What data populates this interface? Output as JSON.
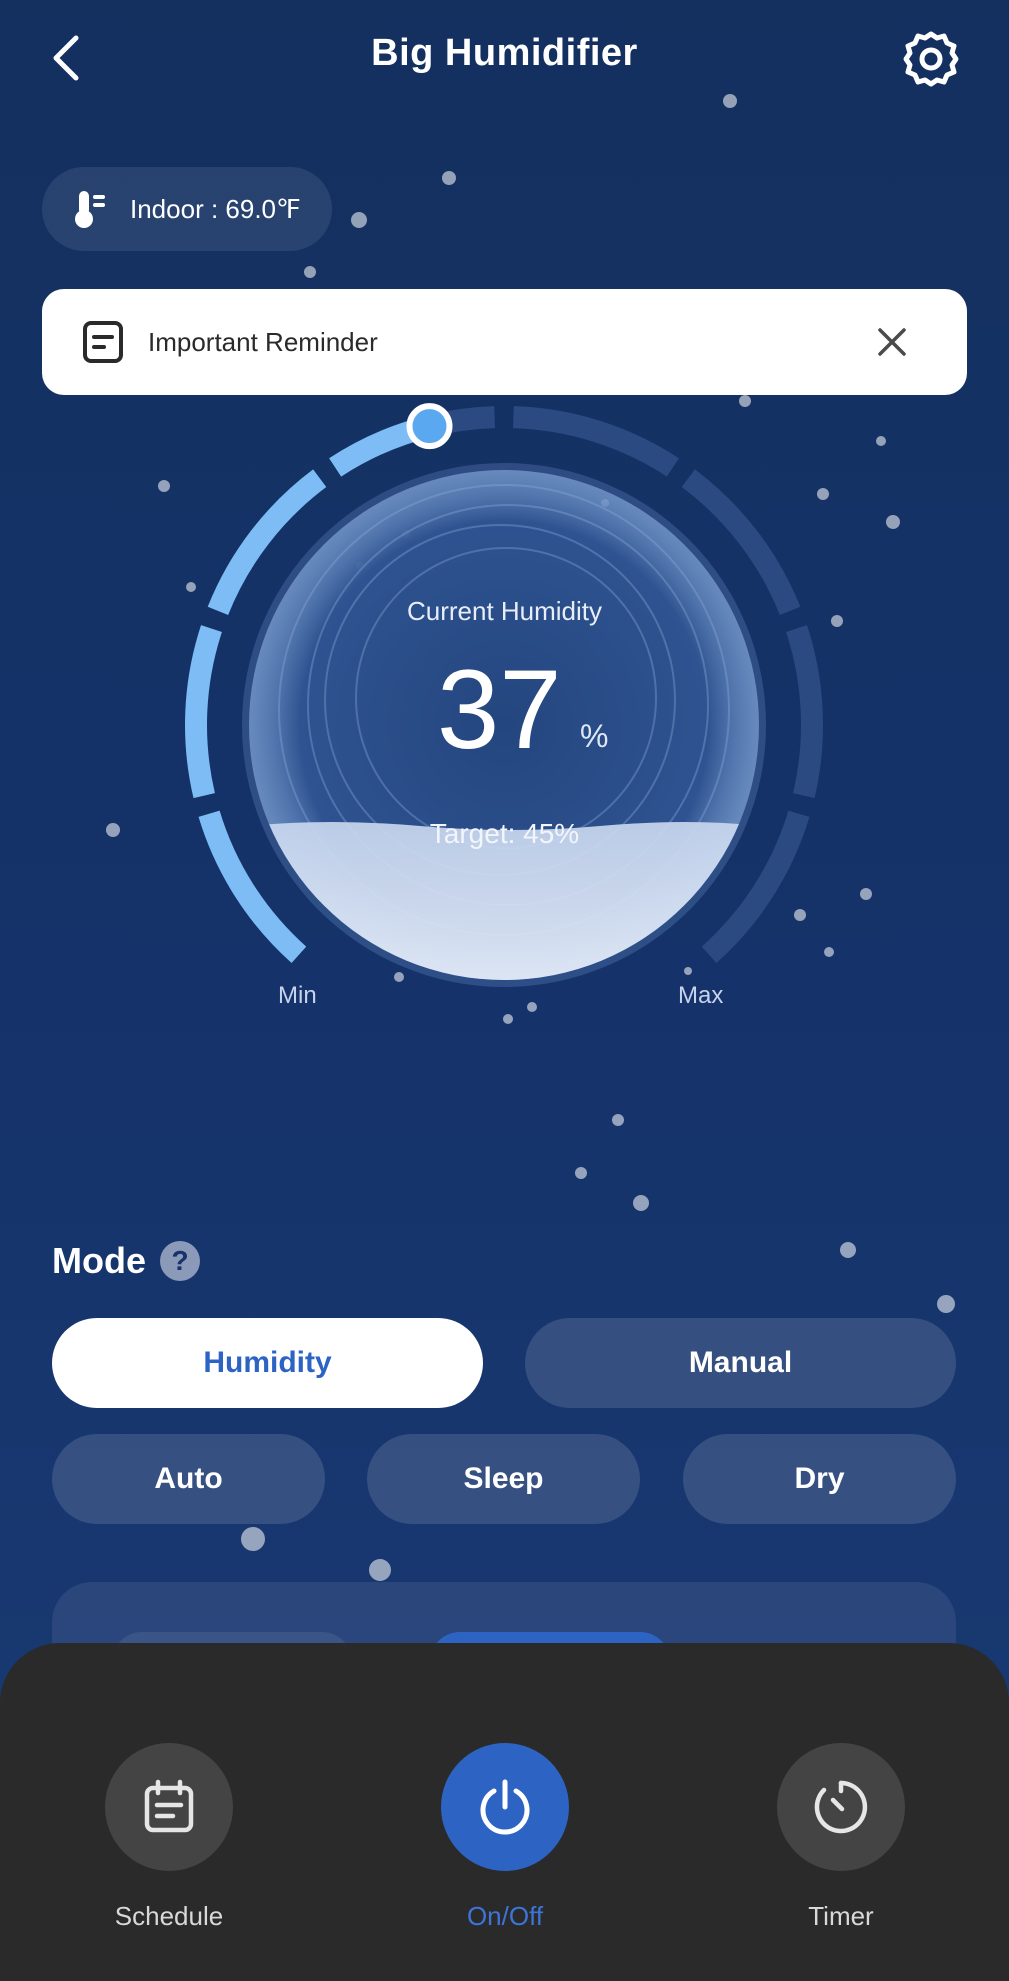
{
  "header": {
    "title": "Big Humidifier",
    "back_icon": "chevron-left-icon",
    "settings_icon": "gear-icon"
  },
  "indoor": {
    "label": "Indoor : 69.0℉",
    "icon": "thermometer-icon"
  },
  "reminder": {
    "label": "Important Reminder",
    "icon": "document-icon",
    "close_icon": "close-icon"
  },
  "gauge": {
    "current_label": "Current Humidity",
    "current_value": "37",
    "unit": "%",
    "target_label": "Target: 45%",
    "min_label": "Min",
    "max_label": "Max",
    "target_fraction": 0.45,
    "current_fraction": 0.37
  },
  "mode": {
    "title": "Mode",
    "help_icon": "question-icon",
    "options": [
      {
        "label": "Humidity",
        "active": true
      },
      {
        "label": "Manual",
        "active": false
      },
      {
        "label": "Auto",
        "active": false
      },
      {
        "label": "Sleep",
        "active": false
      },
      {
        "label": "Dry",
        "active": false
      }
    ]
  },
  "bottom_bar": {
    "schedule": {
      "label": "Schedule",
      "icon": "calendar-icon"
    },
    "power": {
      "label": "On/Off",
      "icon": "power-icon"
    },
    "timer": {
      "label": "Timer",
      "icon": "timer-icon"
    }
  },
  "colors": {
    "background": "#143062",
    "accent": "#2d64c4",
    "arc_active": "#7dbcf5",
    "arc_inactive": "#2c4a82",
    "bottom_bar": "#2a2a2a"
  }
}
